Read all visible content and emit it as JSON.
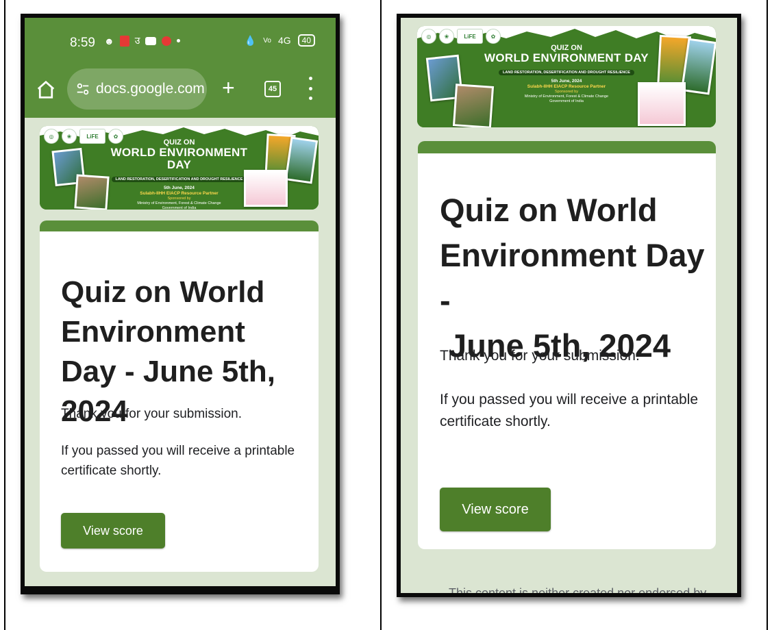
{
  "status_bar": {
    "time": "8:59",
    "network_label": "4G",
    "battery": "40"
  },
  "browser": {
    "url": "docs.google.com",
    "new_tab_label": "+",
    "tab_count": "45"
  },
  "banner": {
    "logo_life": "LiFE",
    "line1": "QUIZ ON",
    "line2": "WORLD ENVIRONMENT DAY",
    "theme": "LAND RESTORATION, DESERTIFICATION AND DROUGHT RESILIENCE",
    "date": "5th June, 2024",
    "partner": "Sulabh-IIHH EIACP Resource Partner",
    "sponsored": "Sponsored by",
    "ministry_line1": "Ministry of Environment, Forest & Climate Change",
    "ministry_line2": "Government of India"
  },
  "form_left": {
    "title": "Quiz on World Environment Day - June 5th, 2024",
    "message1": "Thank you for your submission.",
    "message2": "If you passed you will receive a printable certificate shortly.",
    "button_label": "View score"
  },
  "form_right": {
    "title_line1": "Quiz on World",
    "title_line2": "Environment Day -",
    "title_line3": " June 5th, 2024",
    "message1": "Thank you for your submission.",
    "message2": "If you passed you will receive a printable certificate shortly.",
    "button_label": "View score",
    "footer_partial": "This content is neither created nor endorsed by"
  },
  "colors": {
    "theme_green": "#5a8f3a",
    "button_green": "#4e7f2a",
    "page_bg": "#dbe5d2"
  }
}
